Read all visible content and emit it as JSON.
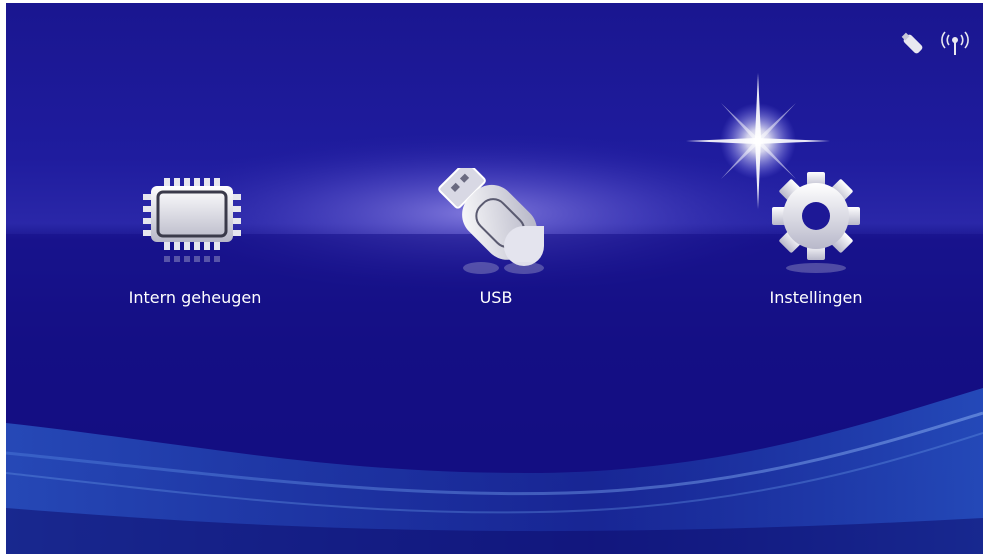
{
  "menu": {
    "items": [
      {
        "label": "Intern geheugen",
        "icon": "memory-chip-icon"
      },
      {
        "label": "USB",
        "icon": "usb-drive-icon"
      },
      {
        "label": "Instellingen",
        "icon": "gear-icon"
      }
    ]
  },
  "status": {
    "icons": [
      "usb-dongle-icon",
      "wireless-signal-icon"
    ]
  },
  "colors": {
    "background_top": "#1f1c9e",
    "background_bottom": "#0f0a74",
    "label": "#ffffff"
  }
}
